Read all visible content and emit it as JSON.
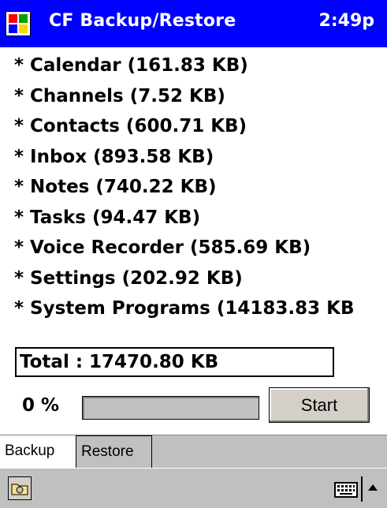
{
  "titlebar": {
    "title": "CF Backup/Restore",
    "time": "2:49p"
  },
  "items": [
    {
      "label": "* Calendar (161.83 KB)"
    },
    {
      "label": "* Channels (7.52 KB)"
    },
    {
      "label": "* Contacts (600.71 KB)"
    },
    {
      "label": "* Inbox (893.58 KB)"
    },
    {
      "label": "* Notes (740.22 KB)"
    },
    {
      "label": "* Tasks (94.47 KB)"
    },
    {
      "label": "* Voice Recorder (585.69 KB)"
    },
    {
      "label": "* Settings (202.92 KB)"
    },
    {
      "label": "* System Programs (14183.83 KB"
    }
  ],
  "total": {
    "label": "Total :  17470.80 KB"
  },
  "progress": {
    "percent_label": "0 %",
    "value": 0
  },
  "start_button": {
    "label": "Start"
  },
  "tabs": [
    {
      "label": "Backup"
    },
    {
      "label": "Restore"
    }
  ],
  "colors": {
    "titlebar": "#0000ff",
    "chrome": "#c0c0c0"
  },
  "icons": {
    "start": "windows-flag-icon",
    "menu": "folder-icon",
    "input": "keyboard-icon",
    "arrow": "up-arrow-icon"
  }
}
